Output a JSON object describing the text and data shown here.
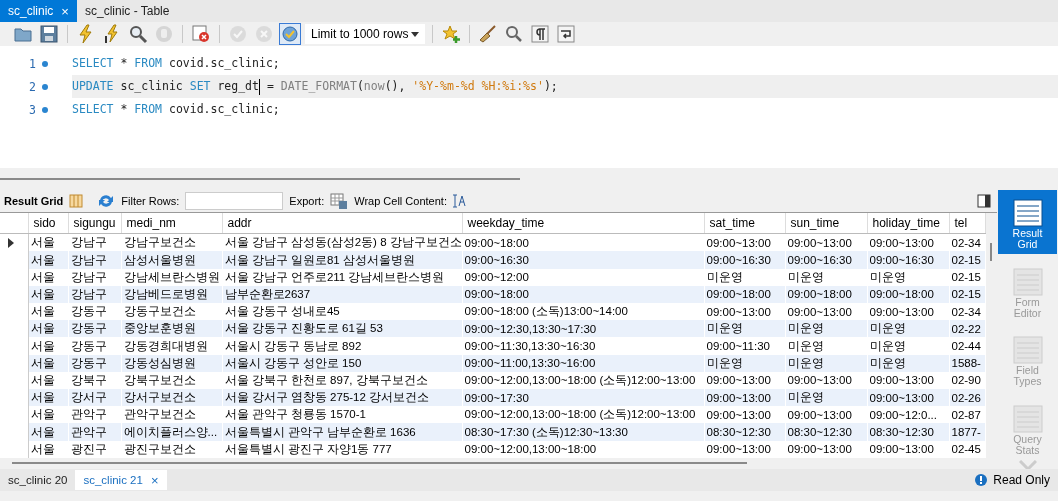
{
  "tabs": [
    {
      "label": "sc_clinic",
      "selected": true,
      "close": "×"
    },
    {
      "label": "sc_clinic - Table",
      "selected": false
    }
  ],
  "toolbar": [
    {
      "kind": "icon",
      "disabled": false,
      "on": false
    },
    {
      "kind": "icon",
      "disabled": false,
      "on": false
    },
    {
      "kind": "separator"
    },
    {
      "kind": "icon",
      "disabled": false,
      "on": false
    },
    {
      "kind": "icon",
      "disabled": false,
      "on": false
    },
    {
      "kind": "icon",
      "disabled": false,
      "on": false
    },
    {
      "kind": "icon",
      "disabled": true,
      "on": false
    },
    {
      "kind": "separator"
    },
    {
      "kind": "icon",
      "disabled": false,
      "on": false
    },
    {
      "kind": "separator"
    },
    {
      "kind": "icon",
      "disabled": true,
      "on": false
    },
    {
      "kind": "icon",
      "disabled": true,
      "on": false
    },
    {
      "kind": "icon",
      "disabled": false,
      "on": true
    },
    {
      "kind": "dropdown",
      "value": "Limit to 1000 rows"
    },
    {
      "kind": "separator"
    },
    {
      "kind": "icon",
      "disabled": false,
      "on": false
    },
    {
      "kind": "separator"
    },
    {
      "kind": "icon",
      "disabled": false,
      "on": false
    },
    {
      "kind": "icon",
      "disabled": false,
      "on": false
    },
    {
      "kind": "icon",
      "disabled": false,
      "on": false
    },
    {
      "kind": "icon",
      "disabled": false,
      "on": false
    }
  ],
  "editor": {
    "lines": [
      {
        "number": "1",
        "current": false,
        "tokens": [
          {
            "kind": "keyword",
            "text": "SELECT"
          },
          {
            "kind": "plain",
            "text": " * "
          },
          {
            "kind": "keyword",
            "text": "FROM"
          },
          {
            "kind": "plain",
            "text": " covid.sc_clinic;"
          }
        ]
      },
      {
        "number": "2",
        "current": true,
        "tokens": [
          {
            "kind": "keyword",
            "text": "UPDATE"
          },
          {
            "kind": "plain",
            "text": " sc_clinic "
          },
          {
            "kind": "keyword",
            "text": "SET"
          },
          {
            "kind": "plain",
            "text": " reg_dt"
          },
          {
            "kind": "cursor"
          },
          {
            "kind": "plain",
            "text": " = "
          },
          {
            "kind": "function",
            "text": "DATE_FORMAT"
          },
          {
            "kind": "plain",
            "text": "("
          },
          {
            "kind": "function",
            "text": "now"
          },
          {
            "kind": "plain",
            "text": "(), "
          },
          {
            "kind": "string",
            "text": "'%Y-%m-%d %H:%i:%s'"
          },
          {
            "kind": "plain",
            "text": ");"
          }
        ]
      },
      {
        "number": "3",
        "current": false,
        "tokens": [
          {
            "kind": "keyword",
            "text": "SELECT"
          },
          {
            "kind": "plain",
            "text": " * "
          },
          {
            "kind": "keyword",
            "text": "FROM"
          },
          {
            "kind": "plain",
            "text": " covid.sc_clinic;"
          }
        ]
      }
    ]
  },
  "result_toolbar": {
    "title": "Result Grid",
    "filter_label": "Filter Rows:",
    "export_label": "Export:",
    "wrap_label": "Wrap Cell Content:"
  },
  "grid": {
    "columns": [
      "sido",
      "sigungu",
      "medi_nm",
      "addr",
      "weekday_time",
      "sat_time",
      "sun_time",
      "holiday_time",
      "tel"
    ],
    "rows": [
      {
        "selected": true,
        "cells": [
          "서울",
          "강남구",
          "강남구보건소",
          "서울 강남구 삼성동(삼성2동) 8 강남구보건소",
          "09:00~18:00",
          "09:00~13:00",
          "09:00~13:00",
          "09:00~13:00",
          "02-34"
        ]
      },
      {
        "selected": false,
        "cells": [
          "서울",
          "강남구",
          "삼성서울병원",
          "서울 강남구 일원로81 삼성서울병원",
          "09:00~16:30",
          "09:00~16:30",
          "09:00~16:30",
          "09:00~16:30",
          "02-15"
        ]
      },
      {
        "selected": false,
        "cells": [
          "서울",
          "강남구",
          "강남세브란스병원",
          "서울 강남구 언주로211 강남세브란스병원",
          "09:00~12:00",
          "미운영",
          "미운영",
          "미운영",
          "02-15"
        ]
      },
      {
        "selected": false,
        "cells": [
          "서울",
          "강남구",
          "강남베드로병원",
          "남부순환로2637",
          "09:00~18:00",
          "09:00~18:00",
          "09:00~18:00",
          "09:00~18:00",
          "02-15"
        ]
      },
      {
        "selected": false,
        "cells": [
          "서울",
          "강동구",
          "강동구보건소",
          "서울 강동구 성내로45",
          "09:00~18:00 (소독)13:00~14:00",
          "09:00~13:00",
          "09:00~13:00",
          "09:00~13:00",
          "02-34"
        ]
      },
      {
        "selected": false,
        "cells": [
          "서울",
          "강동구",
          "중앙보훈병원",
          "서울 강동구 진황도로 61길 53",
          "09:00~12:30,13:30~17:30",
          "미운영",
          "미운영",
          "미운영",
          "02-22"
        ]
      },
      {
        "selected": false,
        "cells": [
          "서울",
          "강동구",
          "강동경희대병원",
          "서울시 강동구 동남로 892",
          "09:00~11:30,13:30~16:30",
          "09:00~11:30",
          "미운영",
          "미운영",
          "02-44"
        ]
      },
      {
        "selected": false,
        "cells": [
          "서울",
          "강동구",
          "강동성심병원",
          "서울시 강동구 성안로 150",
          "09:00~11:00,13:30~16:00",
          "미운영",
          "미운영",
          "미운영",
          "1588-"
        ]
      },
      {
        "selected": false,
        "cells": [
          "서울",
          "강북구",
          "강북구보건소",
          "서울 강북구 한천로 897, 강북구보건소",
          "09:00~12:00,13:00~18:00 (소독)12:00~13:00",
          "09:00~13:00",
          "09:00~13:00",
          "09:00~13:00",
          "02-90"
        ]
      },
      {
        "selected": false,
        "cells": [
          "서울",
          "강서구",
          "강서구보건소",
          "서울 강서구 염창동 275-12 강서보건소",
          "09:00~17:30",
          "09:00~13:00",
          "미운영",
          "09:00~13:00",
          "02-26"
        ]
      },
      {
        "selected": false,
        "cells": [
          "서울",
          "관악구",
          "관악구보건소",
          "서울 관악구 청룡동 1570-1",
          "09:00~12:00,13:00~18:00 (소독)12:00~13:00",
          "09:00~13:00",
          "09:00~13:00",
          "09:00~12:0...",
          "02-87"
        ]
      },
      {
        "selected": false,
        "cells": [
          "서울",
          "관악구",
          "에이치플러스양...",
          "서울특별시 관악구 남부순환로 1636",
          "08:30~17:30 (소독)12:30~13:30",
          "08:30~12:30",
          "08:30~12:30",
          "08:30~12:30",
          "1877-"
        ]
      },
      {
        "selected": false,
        "cells": [
          "서울",
          "광진구",
          "광진구보건소",
          "서울특별시 광진구 자양1동 777",
          "09:00~12:00,13:00~18:00",
          "09:00~13:00",
          "09:00~13:00",
          "09:00~13:00",
          "02-45"
        ]
      }
    ]
  },
  "side_panel": [
    {
      "label": "Result Grid",
      "selected": true
    },
    {
      "label": "Form Editor",
      "selected": false
    },
    {
      "label": "Field Types",
      "selected": false
    },
    {
      "label": "Query Stats",
      "selected": false
    }
  ],
  "result_tabs": [
    {
      "label": "sc_clinic 20",
      "selected": false
    },
    {
      "label": "sc_clinic 21",
      "selected": true,
      "close": "×"
    }
  ],
  "status": {
    "text": "Read Only"
  }
}
